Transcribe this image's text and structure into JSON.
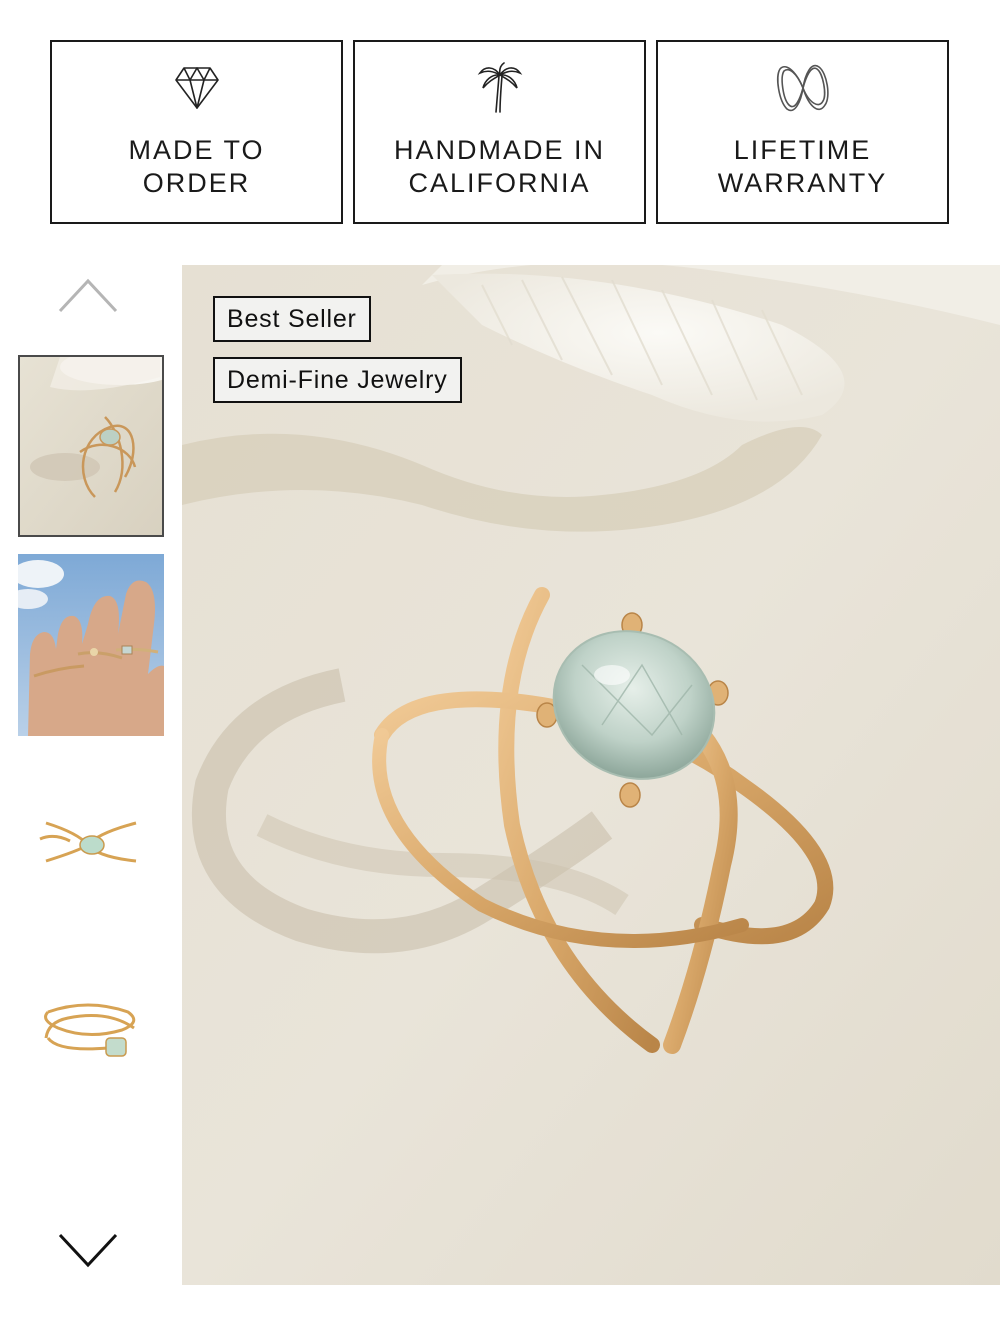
{
  "features": [
    {
      "label": "MADE TO\nORDER",
      "icon": "diamond-icon"
    },
    {
      "label": "HANDMADE IN\nCALIFORNIA",
      "icon": "palm-tree-icon"
    },
    {
      "label": "LIFETIME\nWARRANTY",
      "icon": "infinity-icon"
    }
  ],
  "gallery": {
    "badges": [
      "Best Seller",
      "Demi-Fine Jewelry"
    ],
    "thumbnails": [
      {
        "name": "ring-on-sand-with-shell",
        "selected": true
      },
      {
        "name": "ring-worn-on-hand",
        "selected": false
      },
      {
        "name": "ring-front-view",
        "selected": false
      },
      {
        "name": "ring-side-view",
        "selected": false
      }
    ],
    "main_image": "gold-criss-cross-ring-with-green-stone",
    "nav_icons": [
      "chevron-up-icon",
      "chevron-down-icon"
    ]
  },
  "colors": {
    "border": "#1a1a1a",
    "background": "#ffffff",
    "badge_bg": "#f2f2f0",
    "gold": "#d9a86a"
  }
}
